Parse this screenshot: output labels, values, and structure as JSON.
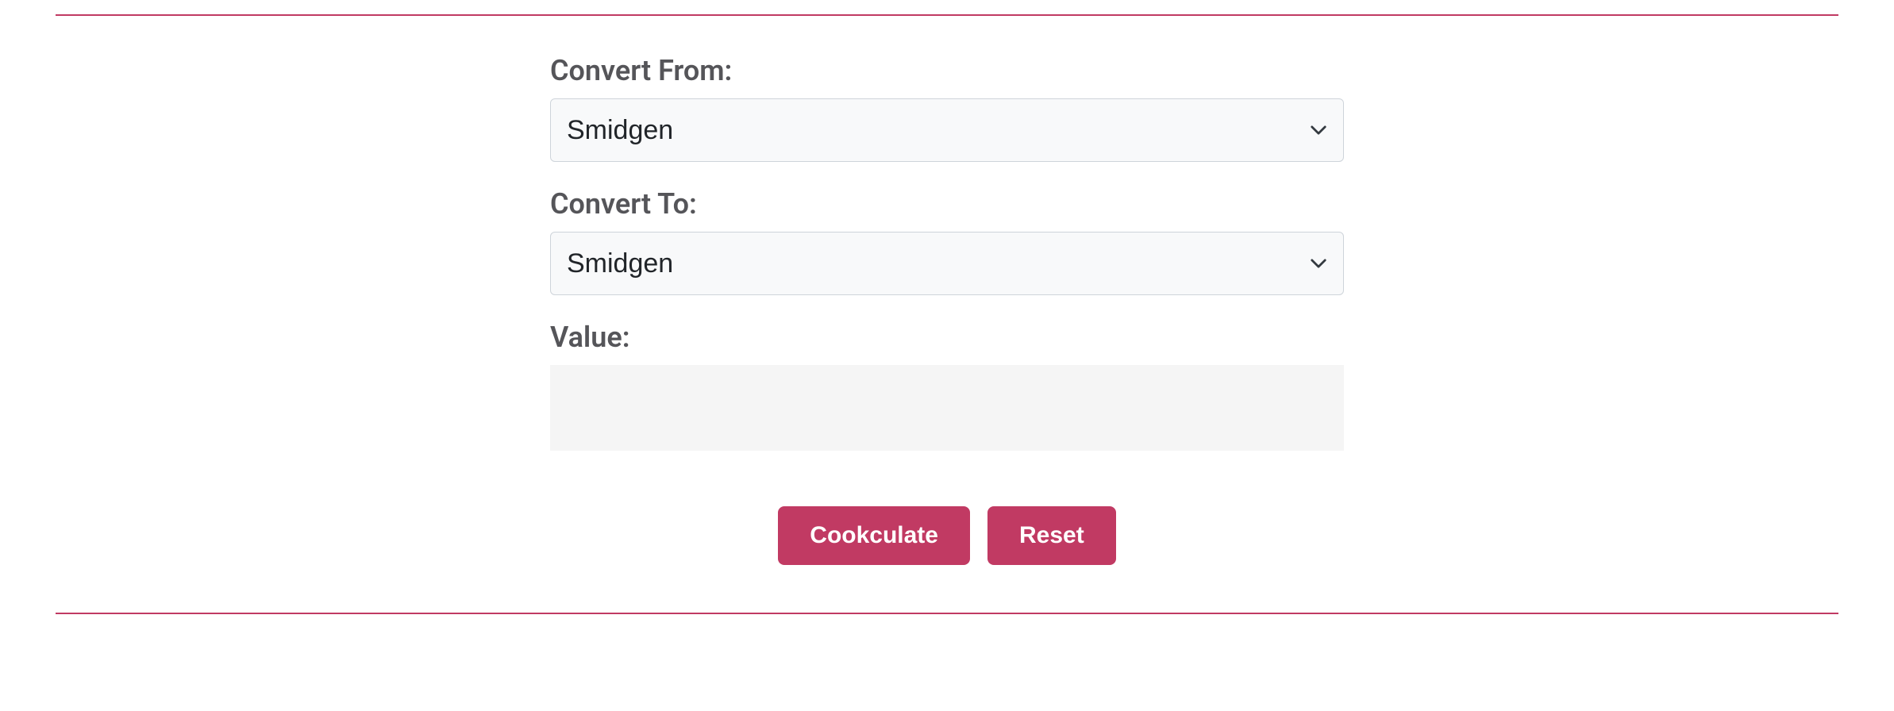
{
  "form": {
    "from_label": "Convert From:",
    "from_value": "Smidgen",
    "to_label": "Convert To:",
    "to_value": "Smidgen",
    "value_label": "Value:",
    "value_input": ""
  },
  "buttons": {
    "calculate_label": "Cookculate",
    "reset_label": "Reset"
  }
}
